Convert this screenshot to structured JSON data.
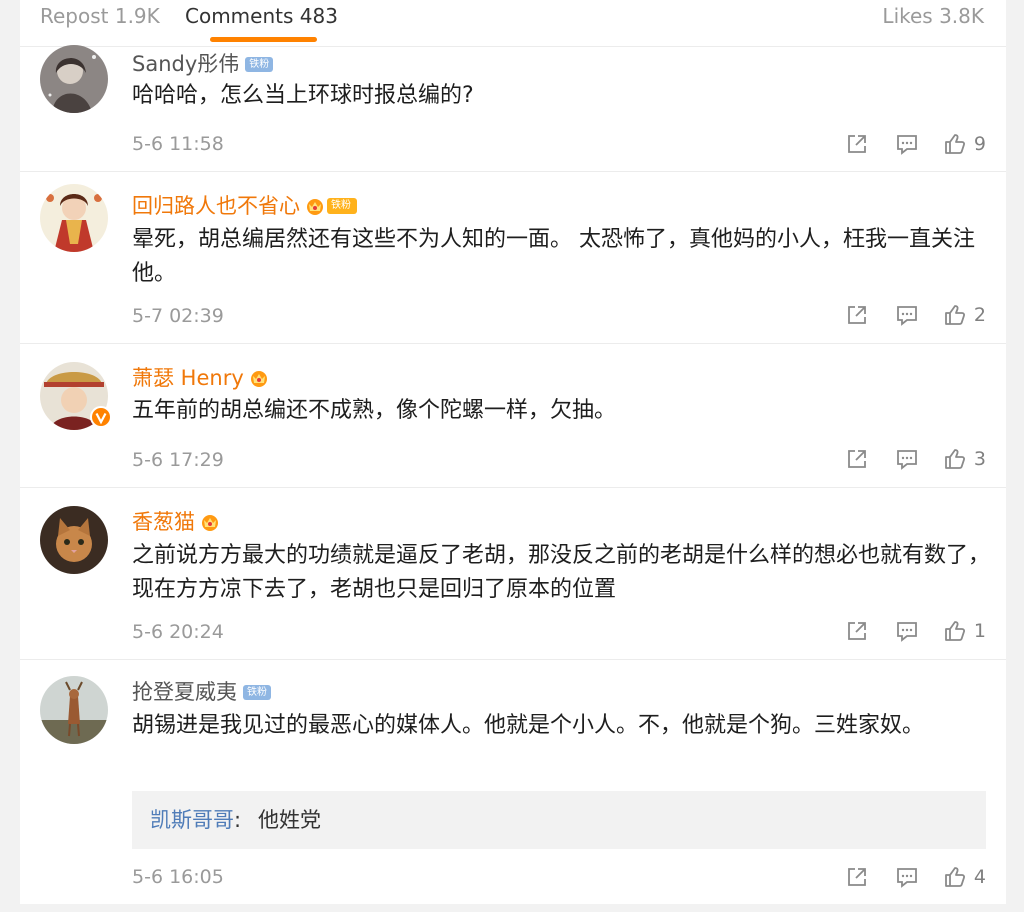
{
  "tabs": {
    "repost": "Repost 1.9K",
    "comments": "Comments 483",
    "likes": "Likes 3.8K",
    "accent_color": "#ff8200"
  },
  "comments": [
    {
      "username": "Sandy彤伟",
      "badge": "铁粉",
      "text": "哈哈哈，怎么当上环球时报总编的?",
      "time": "5-6 11:58",
      "likes": "9"
    },
    {
      "username": "回归路人也不省心",
      "badge": "铁粉",
      "text": "晕死，胡总编居然还有这些不为人知的一面。 太恐怖了，真他妈的小人，枉我一直关注他。",
      "time": "5-7 02:39",
      "likes": "2"
    },
    {
      "username": "萧瑟 Henry",
      "text": "五年前的胡总编还不成熟，像个陀螺一样，欠抽。",
      "time": "5-6 17:29",
      "likes": "3"
    },
    {
      "username": "香葱猫",
      "text": "之前说方方最大的功绩就是逼反了老胡，那没反之前的老胡是什么样的想必也就有数了，现在方方凉下去了，老胡也只是回归了原本的位置",
      "time": "5-6 20:24",
      "likes": "1"
    },
    {
      "username": "抢登夏威夷",
      "badge": "铁粉",
      "text": "胡锡进是我见过的最恶心的媒体人。他就是个小人。不，他就是个狗。三姓家奴。",
      "reply_user": "凯斯哥哥",
      "reply_text": "他姓党",
      "time": "5-6 16:05",
      "likes": "4"
    }
  ],
  "icons": {
    "share": "share-icon",
    "reply": "comment-icon",
    "like": "thumbs-up-icon",
    "vip": "vip-crown-icon"
  },
  "colors": {
    "username_orange": "#f0780a",
    "badge_blue": "#8fb6e3",
    "badge_gold": "#ffb21c",
    "reply_link": "#4f7cb8"
  }
}
